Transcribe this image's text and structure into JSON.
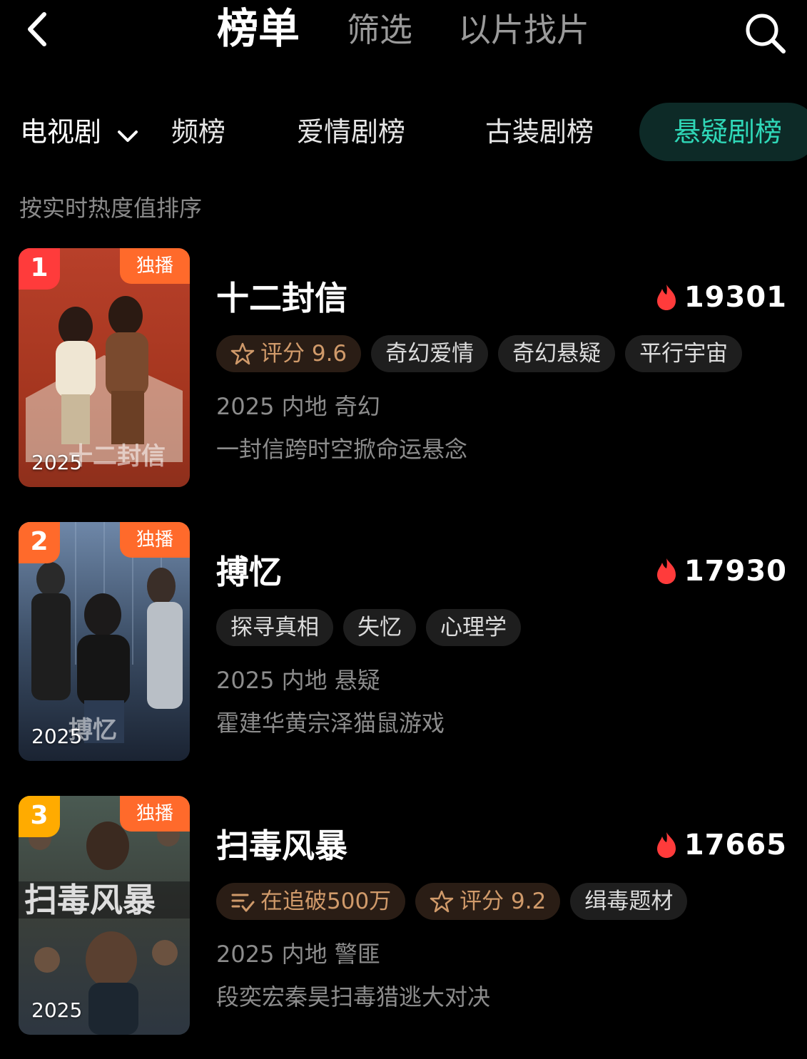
{
  "topbar": {
    "tabs": [
      {
        "label": "榜单",
        "active": true
      },
      {
        "label": "筛选",
        "active": false
      },
      {
        "label": "以片找片",
        "active": false
      }
    ]
  },
  "category": {
    "dropdown_label": "电视剧",
    "tabs": [
      {
        "label": "频榜"
      },
      {
        "label": "爱情剧榜"
      },
      {
        "label": "古装剧榜"
      },
      {
        "label": "悬疑剧榜",
        "active": true
      }
    ],
    "accent_color": "#2fd7b7"
  },
  "sort_hint": "按实时热度值排序",
  "items": [
    {
      "rank": "1",
      "rank_color": "#ff3b3b",
      "exclusive": "独播",
      "poster_year": "2025",
      "poster_art": "十二封信",
      "title": "十二封信",
      "heat": "19301",
      "tags": [
        {
          "label": "评分 9.6",
          "icon": "star-outline-icon",
          "style": "orange"
        },
        {
          "label": "奇幻爱情"
        },
        {
          "label": "奇幻悬疑"
        },
        {
          "label": "平行宇宙"
        }
      ],
      "meta": "2025 内地 奇幻",
      "desc": "一封信跨时空掀命运悬念"
    },
    {
      "rank": "2",
      "rank_color": "#ff6a2b",
      "exclusive": "独播",
      "poster_year": "2025",
      "poster_art": "搏忆",
      "title": "搏忆",
      "heat": "17930",
      "tags": [
        {
          "label": "探寻真相"
        },
        {
          "label": "失忆"
        },
        {
          "label": "心理学"
        }
      ],
      "meta": "2025 内地 悬疑",
      "desc": "霍建华黄宗泽猫鼠游戏"
    },
    {
      "rank": "3",
      "rank_color": "#ffab00",
      "exclusive": "独播",
      "poster_year": "2025",
      "poster_art": "扫毒风暴",
      "title": "扫毒风暴",
      "heat": "17665",
      "tags": [
        {
          "label": "在追破500万",
          "icon": "list-check-icon",
          "style": "orange"
        },
        {
          "label": "评分 9.2",
          "icon": "star-outline-icon",
          "style": "orange"
        },
        {
          "label": "缉毒题材"
        }
      ],
      "meta": "2025 内地 警匪",
      "desc": "段奕宏秦昊扫毒猎逃大对决"
    }
  ]
}
